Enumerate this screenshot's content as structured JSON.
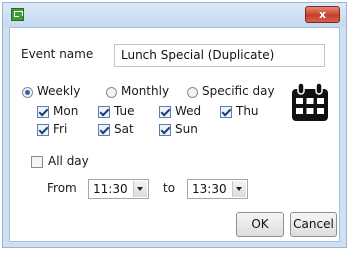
{
  "window": {
    "close_label": "x"
  },
  "form": {
    "event_name_label": "Event name",
    "event_name_value": "Lunch Special (Duplicate)"
  },
  "recurrence": {
    "options": [
      {
        "label": "Weekly",
        "selected": true
      },
      {
        "label": "Monthly",
        "selected": false
      },
      {
        "label": "Specific day",
        "selected": false
      }
    ]
  },
  "days": [
    {
      "label": "Mon",
      "checked": true
    },
    {
      "label": "Tue",
      "checked": true
    },
    {
      "label": "Wed",
      "checked": true
    },
    {
      "label": "Thu",
      "checked": true
    },
    {
      "label": "Fri",
      "checked": true
    },
    {
      "label": "Sat",
      "checked": true
    },
    {
      "label": "Sun",
      "checked": true
    }
  ],
  "all_day": {
    "label": "All day",
    "checked": false
  },
  "time": {
    "from_label": "From",
    "from_value": "11:30",
    "to_label": "to",
    "to_value": "13:30"
  },
  "buttons": {
    "ok": "OK",
    "cancel": "Cancel"
  },
  "icons": {
    "app": "app-icon",
    "calendar": "calendar-icon"
  },
  "colors": {
    "title_bar": "#cfe0f3",
    "close_button": "#c6402b",
    "radio_selected": "#2b63b5",
    "calendar_icon": "#111111"
  }
}
